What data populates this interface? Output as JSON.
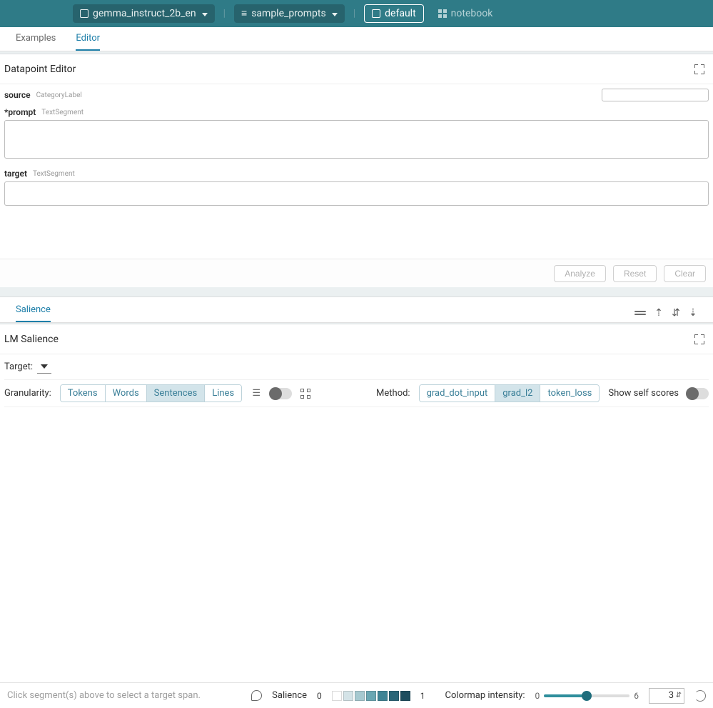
{
  "topbar": {
    "model": "gemma_instruct_2b_en",
    "dataset": "sample_prompts",
    "layout_default": "default",
    "layout_notebook": "notebook"
  },
  "tabs": {
    "examples": "Examples",
    "editor": "Editor"
  },
  "editor": {
    "panel_title": "Datapoint Editor",
    "fields": {
      "source": {
        "name": "source",
        "type": "CategoryLabel"
      },
      "prompt": {
        "name": "*prompt",
        "type": "TextSegment"
      },
      "target": {
        "name": "target",
        "type": "TextSegment"
      }
    },
    "buttons": {
      "analyze": "Analyze",
      "reset": "Reset",
      "clear": "Clear"
    }
  },
  "salience": {
    "tab": "Salience",
    "panel_title": "LM Salience",
    "target_label": "Target:",
    "granularity_label": "Granularity:",
    "granularity": {
      "tokens": "Tokens",
      "words": "Words",
      "sentences": "Sentences",
      "lines": "Lines"
    },
    "method_label": "Method:",
    "methods": {
      "gdi": "grad_dot_input",
      "gl2": "grad_l2",
      "tl": "token_loss"
    },
    "show_self": "Show self scores"
  },
  "bottom": {
    "hint": "Click segment(s) above to select a target span.",
    "salience_label": "Salience",
    "scale_min": "0",
    "scale_max": "1",
    "colormap_label": "Colormap intensity:",
    "cm_min": "0",
    "cm_max": "6",
    "cm_value": "3",
    "swatches": [
      "#ffffff",
      "#d4e3e7",
      "#a6c9d0",
      "#6aa7b3",
      "#3f8495",
      "#2a6678",
      "#1d4d5e"
    ]
  }
}
